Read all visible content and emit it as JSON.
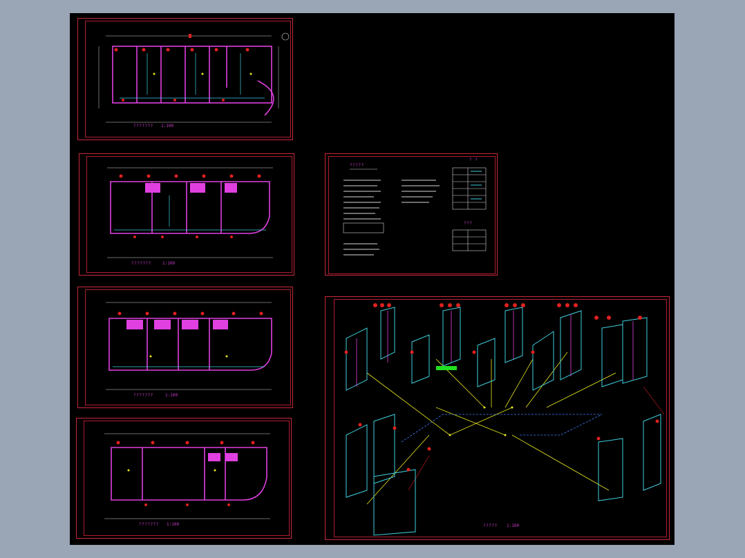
{
  "viewer": {
    "background": "#000000",
    "chrome": "#9aa6b6"
  },
  "sheets": [
    {
      "id": "plan-1",
      "title": "???????",
      "scale": "1:100"
    },
    {
      "id": "plan-2",
      "title": "???????",
      "scale": "1:100"
    },
    {
      "id": "plan-3",
      "title": "???????",
      "scale": "1:100"
    },
    {
      "id": "plan-4",
      "title": "???????",
      "scale": "1:100"
    },
    {
      "id": "notes",
      "title": "?????",
      "legend_title": "? ?",
      "table_title": "???"
    },
    {
      "id": "axonometric",
      "title": "?????",
      "scale": "1:100"
    }
  ],
  "colors": {
    "frame": "#c8283a",
    "wall": "#e040e0",
    "pipe": "#40d0e0",
    "fixture": "#e02020",
    "dim": "#d8d8d8",
    "yellow": "#e8e820",
    "green": "#20e020",
    "blue": "#4080ff"
  }
}
